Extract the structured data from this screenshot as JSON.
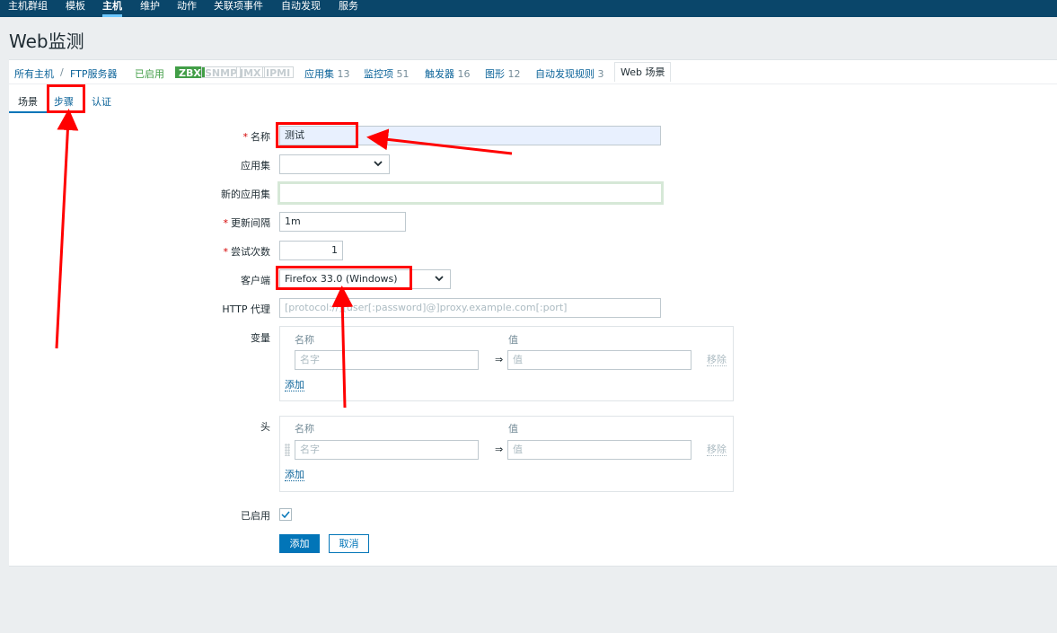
{
  "topnav": {
    "items": [
      "主机群组",
      "模板",
      "主机",
      "维护",
      "动作",
      "关联项事件",
      "自动发现",
      "服务"
    ],
    "active": "主机"
  },
  "page": {
    "title": "Web监测"
  },
  "hostnav": {
    "all_hosts": "所有主机",
    "separator": "/",
    "host": "FTP服务器",
    "enabled": "已启用",
    "badges": [
      "ZBX",
      "SNMP",
      "JMX",
      "IPMI"
    ],
    "applications": {
      "label": "应用集",
      "count": "13"
    },
    "items": {
      "label": "监控项",
      "count": "51"
    },
    "triggers": {
      "label": "触发器",
      "count": "16"
    },
    "graphs": {
      "label": "图形",
      "count": "12"
    },
    "discovery": {
      "label": "自动发现规则",
      "count": "3"
    },
    "web": "Web 场景"
  },
  "tabs": [
    "场景",
    "步骤",
    "认证"
  ],
  "form": {
    "name": {
      "label": "名称",
      "value": "测试"
    },
    "application": {
      "label": "应用集",
      "value": ""
    },
    "new_application": {
      "label": "新的应用集",
      "value": ""
    },
    "update_interval": {
      "label": "更新间隔",
      "value": "1m"
    },
    "attempts": {
      "label": "尝试次数",
      "value": "1"
    },
    "agent": {
      "label": "客户端",
      "value": "Firefox 33.0 (Windows)"
    },
    "http_proxy": {
      "label": "HTTP 代理",
      "placeholder": "[protocol://][user[:password]@]proxy.example.com[:port]"
    },
    "variables": {
      "label": "变量",
      "col_name": "名称",
      "col_value": "值",
      "name_placeholder": "名字",
      "value_placeholder": "值",
      "eq": "⇒",
      "remove": "移除",
      "add": "添加"
    },
    "headers": {
      "label": "头",
      "col_name": "名称",
      "col_value": "值",
      "name_placeholder": "名字",
      "value_placeholder": "值",
      "eq": "⇒",
      "remove": "移除",
      "add": "添加"
    },
    "enabled": {
      "label": "已启用",
      "checked": true
    },
    "buttons": {
      "add": "添加",
      "cancel": "取消"
    }
  }
}
